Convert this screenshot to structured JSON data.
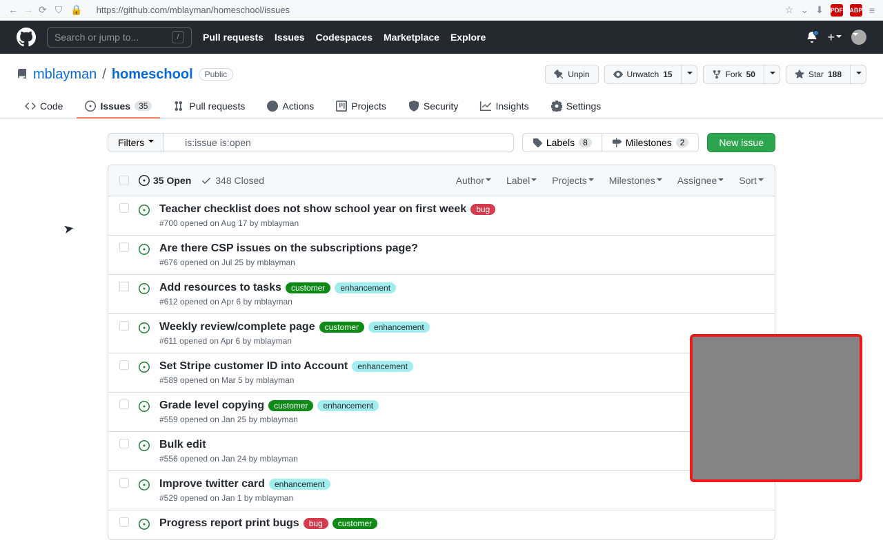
{
  "browser": {
    "url": "https://github.com/mblayman/homeschool/issues"
  },
  "topnav": {
    "search_placeholder": "Search or jump to...",
    "slash": "/",
    "links": [
      "Pull requests",
      "Issues",
      "Codespaces",
      "Marketplace",
      "Explore"
    ]
  },
  "repo": {
    "owner": "mblayman",
    "name": "homeschool",
    "visibility": "Public",
    "actions": {
      "unpin": "Unpin",
      "unwatch": "Unwatch",
      "watch_count": "15",
      "fork": "Fork",
      "fork_count": "50",
      "star": "Star",
      "star_count": "188"
    },
    "tabs": {
      "code": "Code",
      "issues": "Issues",
      "issues_count": "35",
      "pulls": "Pull requests",
      "actions": "Actions",
      "projects": "Projects",
      "security": "Security",
      "insights": "Insights",
      "settings": "Settings"
    }
  },
  "filters": {
    "button": "Filters",
    "query": "is:issue is:open",
    "labels": "Labels",
    "labels_count": "8",
    "milestones": "Milestones",
    "milestones_count": "2",
    "new_issue": "New issue"
  },
  "list_header": {
    "open": "35 Open",
    "closed": "348 Closed",
    "filter_menus": [
      "Author",
      "Label",
      "Projects",
      "Milestones",
      "Assignee",
      "Sort"
    ]
  },
  "issues": [
    {
      "title": "Teacher checklist does not show school year on first week",
      "labels": [
        {
          "text": "bug",
          "cls": "label-bug"
        }
      ],
      "meta": "#700 opened on Aug 17 by mblayman"
    },
    {
      "title": "Are there CSP issues on the subscriptions page?",
      "labels": [],
      "meta": "#676 opened on Jul 25 by mblayman"
    },
    {
      "title": "Add resources to tasks",
      "labels": [
        {
          "text": "customer",
          "cls": "label-customer"
        },
        {
          "text": "enhancement",
          "cls": "label-enhancement"
        }
      ],
      "meta": "#612 opened on Apr 6 by mblayman"
    },
    {
      "title": "Weekly review/complete page",
      "labels": [
        {
          "text": "customer",
          "cls": "label-customer"
        },
        {
          "text": "enhancement",
          "cls": "label-enhancement"
        }
      ],
      "meta": "#611 opened on Apr 6 by mblayman"
    },
    {
      "title": "Set Stripe customer ID into Account",
      "labels": [
        {
          "text": "enhancement",
          "cls": "label-enhancement"
        }
      ],
      "meta": "#589 opened on Mar 5 by mblayman"
    },
    {
      "title": "Grade level copying",
      "labels": [
        {
          "text": "customer",
          "cls": "label-customer"
        },
        {
          "text": "enhancement",
          "cls": "label-enhancement"
        }
      ],
      "meta": "#559 opened on Jan 25 by mblayman"
    },
    {
      "title": "Bulk edit",
      "labels": [],
      "meta": "#556 opened on Jan 24 by mblayman"
    },
    {
      "title": "Improve twitter card",
      "labels": [
        {
          "text": "enhancement",
          "cls": "label-enhancement"
        }
      ],
      "meta": "#529 opened on Jan 1 by mblayman"
    },
    {
      "title": "Progress report print bugs",
      "labels": [
        {
          "text": "bug",
          "cls": "label-bug"
        },
        {
          "text": "customer",
          "cls": "label-customer"
        }
      ],
      "meta": ""
    }
  ]
}
